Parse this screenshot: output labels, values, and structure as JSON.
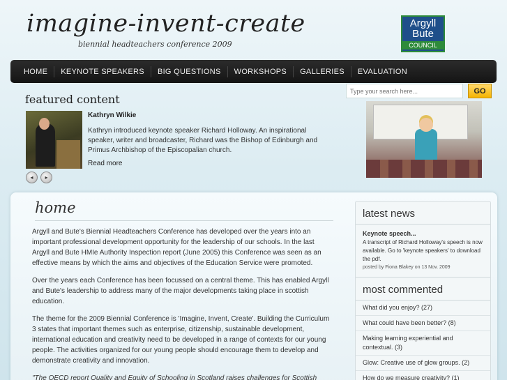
{
  "header": {
    "title": "imagine-invent-create",
    "subtitle": "biennial headteachers conference 2009",
    "logo": {
      "line1": "Argyll",
      "line2": "Bute",
      "line3": "COUNCIL"
    }
  },
  "nav": {
    "items": [
      "HOME",
      "KEYNOTE SPEAKERS",
      "BIG QUESTIONS",
      "WORKSHOPS",
      "GALLERIES",
      "EVALUATION"
    ]
  },
  "featured": {
    "heading": "featured content",
    "name": "Kathryn Wilkie",
    "text": "Kathryn introduced keynote speaker Richard Holloway. An inspirational speaker, writer and broadcaster, Richard was the Bishop of Edinburgh and Primus Archbishop of the Episcopalian church.",
    "read_more": "Read more",
    "prev_icon": "◂",
    "next_icon": "▸"
  },
  "search": {
    "placeholder": "Type your search here...",
    "button": "GO"
  },
  "main": {
    "title": "home",
    "paragraphs": [
      "Argyll and Bute's Biennial Headteachers Conference has developed over the years into an important professional development opportunity for the leadership of our schools. In the last Argyll and Bute HMIe Authority Inspection report (June 2005) this Conference was seen as an effective means by which the aims and objectives of the Education Service were promoted.",
      "Over the years each Conference has been focussed on a central theme. This has enabled Argyll and Bute's leadership to address many of the major developments taking place in scottish education.",
      "The theme for the 2009 Biennial Conference is 'Imagine, Invent, Create'. Building the Curriculum 3 states that important themes such as enterprise, citizenship, sustainable development, international education and creativity need to be developed in a range of contexts for our young people. The activities organized for our young people should encourage them to develop and demonstrate creativity and innovation.",
      "\"The OECD report Quality and Equity of Schooling in Scotland raises challenges for Scottish"
    ]
  },
  "sidebar": {
    "latest_news_heading": "latest news",
    "news": {
      "title": "Keynote speech...",
      "text": "A transcript of Richard Holloway's speech is now available. Go to 'keynote speakers' to download the pdf.",
      "meta": "posted by Fiona Blakey on 13 Nov. 2009"
    },
    "most_commented_heading": "most commented",
    "most_commented": [
      "What did you enjoy? (27)",
      "What could have been better? (8)",
      "Making learning experiential and contextual. (3)",
      "Glow: Creative use of glow groups. (2)",
      "How do we measure creativity? (1)"
    ]
  }
}
